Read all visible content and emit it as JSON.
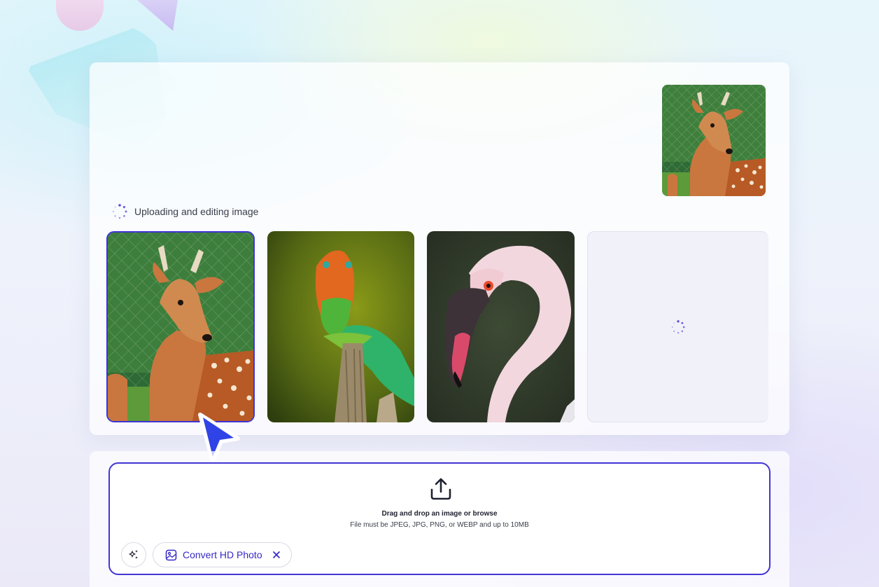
{
  "colors": {
    "accent": "#3f33d6",
    "spinner": "#5b4fe0",
    "chip_text": "#3529c7"
  },
  "status": {
    "text": "Uploading and editing image",
    "icon": "loading-spinner-icon"
  },
  "gallery": {
    "items": [
      {
        "subject": "deer",
        "selected": true
      },
      {
        "subject": "lizard",
        "selected": false
      },
      {
        "subject": "flamingo",
        "selected": false
      },
      {
        "subject": "loading",
        "selected": false
      }
    ]
  },
  "upload": {
    "icon": "upload-icon",
    "title": "Drag and drop an image or browse",
    "subtitle": "File must be JPEG, JPG, PNG, or WEBP and up to 10MB"
  },
  "toolbar": {
    "magic_icon": "sparkles-icon",
    "chip_icon": "image-icon",
    "chip_label": "Convert HD Photo",
    "chip_close_icon": "close-icon"
  }
}
